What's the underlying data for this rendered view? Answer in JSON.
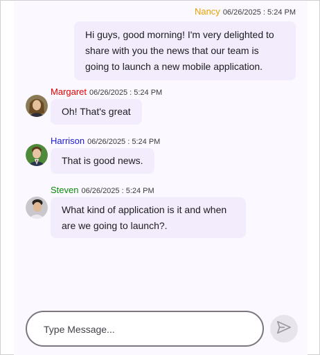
{
  "messages": [
    {
      "author": "Nancy",
      "author_color": "#e8a200",
      "time": "06/26/2025 : 5:24 PM",
      "text": "Hi guys, good morning! I'm very delighted to share with you the news that our team is going to launch a new mobile application.",
      "outgoing": true
    },
    {
      "author": "Margaret",
      "author_color": "#e00000",
      "time": "06/26/2025 : 5:24 PM",
      "text": "Oh! That's great",
      "avatar_icon": "avatar-woman-icon"
    },
    {
      "author": "Harrison",
      "author_color": "#1a1ad0",
      "time": "06/26/2025 : 5:24 PM",
      "text": "That is good news.",
      "avatar_icon": "avatar-man-suit-icon"
    },
    {
      "author": "Steven",
      "author_color": "#0a8a0a",
      "time": "06/26/2025 : 5:24 PM",
      "text": "What kind of application is it and when are we going to launch?.",
      "avatar_icon": "avatar-man-icon"
    }
  ],
  "composer": {
    "placeholder": "Type Message...",
    "send_icon": "send-icon"
  }
}
